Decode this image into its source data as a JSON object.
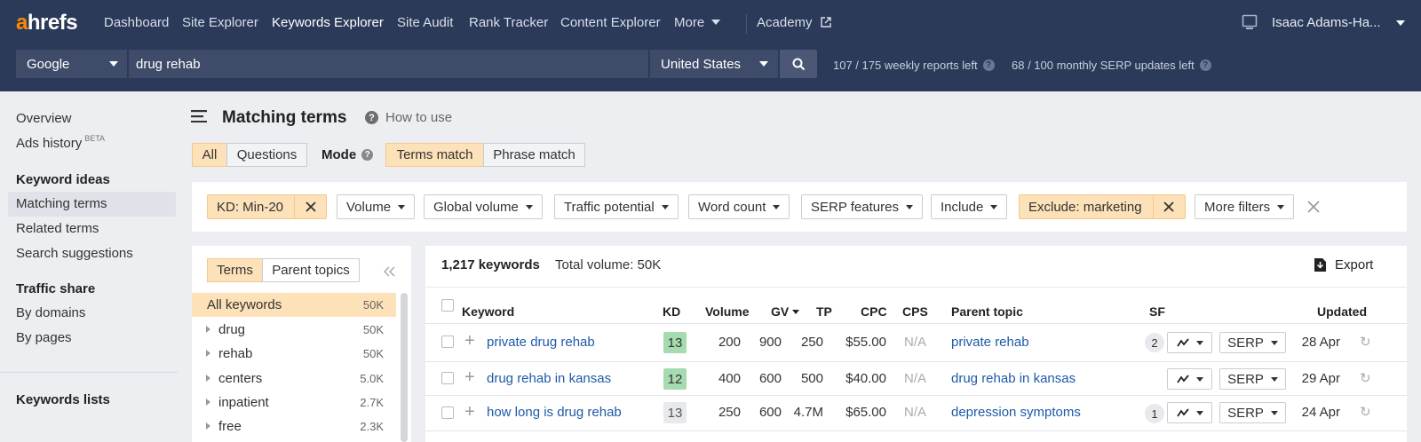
{
  "brand": {
    "logo_a": "a",
    "logo_rest": "hrefs",
    "accent": "#ff8800",
    "nav_bg": "#2b3a58"
  },
  "nav": {
    "items": [
      "Dashboard",
      "Site Explorer",
      "Keywords Explorer",
      "Site Audit",
      "Rank Tracker",
      "Content Explorer",
      "More",
      "Academy"
    ],
    "active": "Keywords Explorer",
    "user": "Isaac Adams-Ha..."
  },
  "search": {
    "engine": "Google",
    "query": "drug rehab",
    "country": "United States",
    "weekly_reports": "107 / 175 weekly reports left",
    "serp_updates": "68 / 100 monthly SERP updates left"
  },
  "sidebar": {
    "top": [
      "Overview",
      "Ads history"
    ],
    "beta": "BETA",
    "keyword_ideas": {
      "heading": "Keyword ideas",
      "items": [
        "Matching terms",
        "Related terms",
        "Search suggestions"
      ],
      "active": "Matching terms"
    },
    "traffic_share": {
      "heading": "Traffic share",
      "items": [
        "By domains",
        "By pages"
      ]
    },
    "keywords_lists": "Keywords lists"
  },
  "header": {
    "title": "Matching terms",
    "how_to": "How to use",
    "scope": [
      "All",
      "Questions"
    ],
    "scope_active": "All",
    "mode_label": "Mode",
    "modes": [
      "Terms match",
      "Phrase match"
    ],
    "mode_active": "Terms match"
  },
  "filters": {
    "kd": "KD: Min-20",
    "volume": "Volume",
    "global_volume": "Global volume",
    "traffic_potential": "Traffic potential",
    "word_count": "Word count",
    "serp_features": "SERP features",
    "include": "Include",
    "exclude": "Exclude: marketing",
    "more": "More filters"
  },
  "terms_panel": {
    "tabs": [
      "Terms",
      "Parent topics"
    ],
    "tab_active": "Terms",
    "rows": [
      {
        "name": "All keywords",
        "value": "50K",
        "active": true
      },
      {
        "name": "drug",
        "value": "50K"
      },
      {
        "name": "rehab",
        "value": "50K"
      },
      {
        "name": "centers",
        "value": "5.0K"
      },
      {
        "name": "inpatient",
        "value": "2.7K"
      },
      {
        "name": "free",
        "value": "2.3K"
      }
    ]
  },
  "results": {
    "count": "1,217 keywords",
    "total_volume": "Total volume: 50K",
    "export": "Export",
    "columns": [
      "Keyword",
      "KD",
      "Volume",
      "GV",
      "TP",
      "CPC",
      "CPS",
      "Parent topic",
      "SF",
      "Updated"
    ],
    "rows": [
      {
        "keyword": "private drug rehab",
        "kd": "13",
        "kd_color": "#a6dbb0",
        "volume": "200",
        "gv": "900",
        "tp": "250",
        "cpc": "$55.00",
        "cps": "N/A",
        "parent": "private rehab",
        "sf": "2",
        "serp": "SERP",
        "updated": "28 Apr"
      },
      {
        "keyword": "drug rehab in kansas",
        "kd": "12",
        "kd_color": "#a6dbb0",
        "volume": "400",
        "gv": "600",
        "tp": "500",
        "cpc": "$40.00",
        "cps": "N/A",
        "parent": "drug rehab in kansas",
        "sf": "",
        "serp": "SERP",
        "updated": "29 Apr"
      },
      {
        "keyword": "how long is drug rehab",
        "kd": "13",
        "kd_color": "#e8e9ec",
        "volume": "250",
        "gv": "600",
        "tp": "4.7M",
        "cpc": "$65.00",
        "cps": "N/A",
        "parent": "depression symptoms",
        "sf": "1",
        "serp": "SERP",
        "updated": "24 Apr"
      }
    ]
  }
}
